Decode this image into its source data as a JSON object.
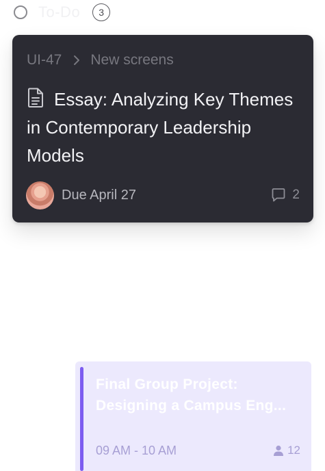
{
  "column": {
    "title": "To-Do",
    "count": "3"
  },
  "task_card": {
    "breadcrumb": {
      "project": "UI-47",
      "section": "New screens"
    },
    "title": "Essay: Analyzing Key Themes in Contemporary Leadership Models",
    "due": "Due April 27",
    "comment_count": "2",
    "icons": {
      "type": "document-icon",
      "separator": "chevron-right-icon",
      "comments": "comment-icon"
    }
  },
  "event_card": {
    "title_line1": "Final Group Project:",
    "title_line2": "Designing a Campus Eng...",
    "time": "09 AM - 10 AM",
    "attendee_count": "12",
    "accent_color": "#7c5cf0",
    "background_color": "#ece9fd"
  }
}
